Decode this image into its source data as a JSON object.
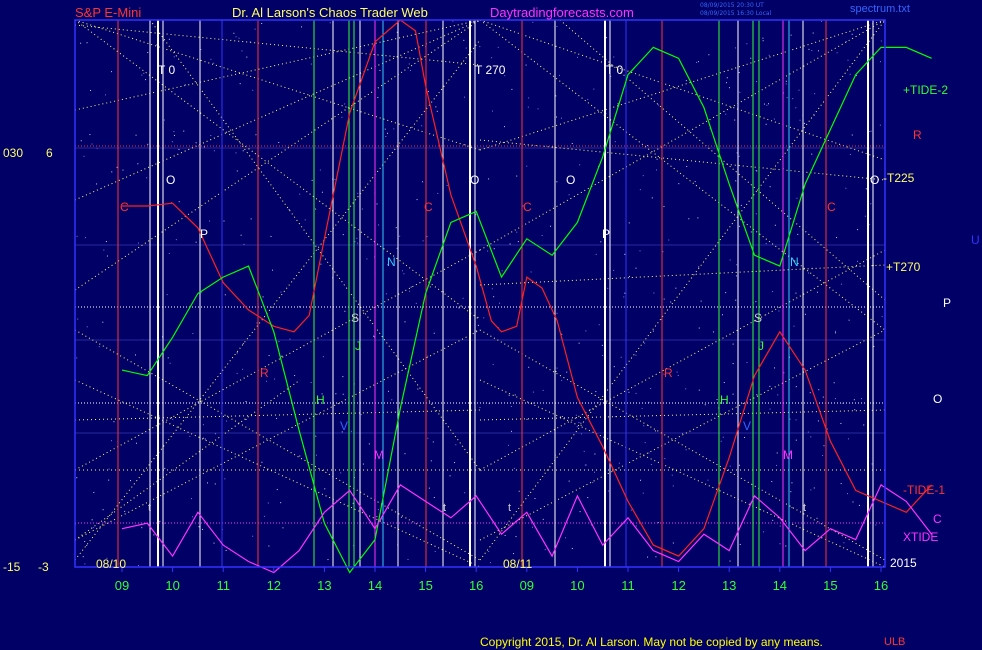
{
  "header": {
    "left": "S&P E-Mini",
    "center": "Dr. Al Larson's Chaos Trader Web",
    "site": "Daytradingforecasts.com",
    "stamp1": "08/09/2015 20:30 UT",
    "stamp2": "08/09/2015 16:30 Local",
    "file": "spectrum.txt"
  },
  "footer": {
    "copyright": "Copyright 2015, Dr. Al Larson. May not be copied by any means.",
    "corner": "ULB"
  },
  "left_labels": {
    "a": "030",
    "b": "6",
    "c": "-15",
    "d": "-3"
  },
  "right_labels": {
    "tide2": "+TIDE-2",
    "r": "R",
    "t225": "-T225",
    "u": "U",
    "t270": "+T270",
    "p": "P",
    "o": "O",
    "tide1": "-TIDE-1",
    "c": "C",
    "xtide": "XTIDE",
    "year": "2015"
  },
  "chart_data": {
    "type": "line",
    "x_ticks": [
      "09",
      "10",
      "11",
      "12",
      "13",
      "14",
      "15",
      "16",
      "09",
      "10",
      "11",
      "12",
      "13",
      "14",
      "15",
      "16"
    ],
    "date_labels": [
      "08/10",
      "08/11"
    ],
    "lines": [
      {
        "name": "red",
        "color": "#ff2020",
        "points": [
          [
            0,
            0.66
          ],
          [
            0.5,
            0.66
          ],
          [
            1,
            0.665
          ],
          [
            1.5,
            0.62
          ],
          [
            2,
            0.52
          ],
          [
            2.5,
            0.47
          ],
          [
            3,
            0.44
          ],
          [
            3.4,
            0.43
          ],
          [
            3.7,
            0.46
          ],
          [
            4,
            0.6
          ],
          [
            4.5,
            0.83
          ],
          [
            5,
            0.96
          ],
          [
            5.5,
            1.0
          ],
          [
            5.8,
            0.98
          ],
          [
            6,
            0.88
          ],
          [
            6.5,
            0.68
          ],
          [
            7,
            0.55
          ],
          [
            7.3,
            0.45
          ],
          [
            7.5,
            0.43
          ],
          [
            7.8,
            0.44
          ],
          [
            8,
            0.53
          ],
          [
            8.3,
            0.51
          ],
          [
            8.6,
            0.45
          ],
          [
            9,
            0.31
          ],
          [
            9.5,
            0.22
          ],
          [
            10,
            0.12
          ],
          [
            10.5,
            0.04
          ],
          [
            11,
            0.02
          ],
          [
            11.5,
            0.07
          ],
          [
            12,
            0.2
          ],
          [
            12.5,
            0.35
          ],
          [
            13,
            0.43
          ],
          [
            13.5,
            0.36
          ],
          [
            14,
            0.23
          ],
          [
            14.5,
            0.14
          ],
          [
            15,
            0.12
          ],
          [
            15.5,
            0.1
          ],
          [
            16,
            0.15
          ]
        ]
      },
      {
        "name": "green",
        "color": "#00ff00",
        "points": [
          [
            0,
            0.36
          ],
          [
            0.5,
            0.35
          ],
          [
            1,
            0.42
          ],
          [
            1.5,
            0.5
          ],
          [
            2,
            0.53
          ],
          [
            2.5,
            0.55
          ],
          [
            3,
            0.43
          ],
          [
            3.5,
            0.25
          ],
          [
            4,
            0.08
          ],
          [
            4.5,
            -0.01
          ],
          [
            5,
            0.05
          ],
          [
            5.5,
            0.29
          ],
          [
            6,
            0.5
          ],
          [
            6.5,
            0.63
          ],
          [
            7,
            0.65
          ],
          [
            7.5,
            0.53
          ],
          [
            8,
            0.6
          ],
          [
            8.5,
            0.57
          ],
          [
            9,
            0.63
          ],
          [
            9.5,
            0.75
          ],
          [
            10,
            0.9
          ],
          [
            10.5,
            0.95
          ],
          [
            11,
            0.93
          ],
          [
            11.5,
            0.84
          ],
          [
            12,
            0.7
          ],
          [
            12.5,
            0.57
          ],
          [
            13,
            0.55
          ],
          [
            13.5,
            0.7
          ],
          [
            14,
            0.8
          ],
          [
            14.5,
            0.9
          ],
          [
            15,
            0.95
          ],
          [
            15.5,
            0.95
          ],
          [
            16,
            0.93
          ]
        ]
      },
      {
        "name": "magenta",
        "color": "#ff33ff",
        "points": [
          [
            0,
            0.07
          ],
          [
            0.5,
            0.08
          ],
          [
            1,
            0.02
          ],
          [
            1.5,
            0.1
          ],
          [
            2,
            0.04
          ],
          [
            2.5,
            0.01
          ],
          [
            3,
            -0.01
          ],
          [
            3.5,
            0.03
          ],
          [
            4,
            0.1
          ],
          [
            4.5,
            0.14
          ],
          [
            5,
            0.07
          ],
          [
            5.5,
            0.15
          ],
          [
            6,
            0.12
          ],
          [
            6.5,
            0.09
          ],
          [
            7,
            0.13
          ],
          [
            7.5,
            0.06
          ],
          [
            8,
            0.1
          ],
          [
            8.5,
            0.02
          ],
          [
            9,
            0.13
          ],
          [
            9.5,
            0.04
          ],
          [
            10,
            0.09
          ],
          [
            10.5,
            0.03
          ],
          [
            11,
            0.01
          ],
          [
            11.5,
            0.06
          ],
          [
            12,
            0.03
          ],
          [
            12.5,
            0.13
          ],
          [
            13,
            0.09
          ],
          [
            13.5,
            0.03
          ],
          [
            14,
            0.07
          ],
          [
            14.5,
            0.05
          ],
          [
            15,
            0.15
          ],
          [
            15.5,
            0.12
          ],
          [
            16,
            0.06
          ]
        ]
      }
    ]
  },
  "annotations": {
    "t0_left": "T   0",
    "t270": "T   270",
    "t0_right": "T   0",
    "o": "O",
    "p": "P",
    "c": "C",
    "n": "N",
    "s": "S",
    "j": "J",
    "r": "R",
    "h": "H",
    "v": "V",
    "m": "M",
    "t": "t"
  },
  "colors": {
    "background": "#000066",
    "frame": "#3333ff",
    "dotted": "#ffff66",
    "header_red": "#ff3333",
    "header_yellow": "#ffff66",
    "header_magenta": "#ff33ff",
    "tick_green": "#33ff33"
  }
}
